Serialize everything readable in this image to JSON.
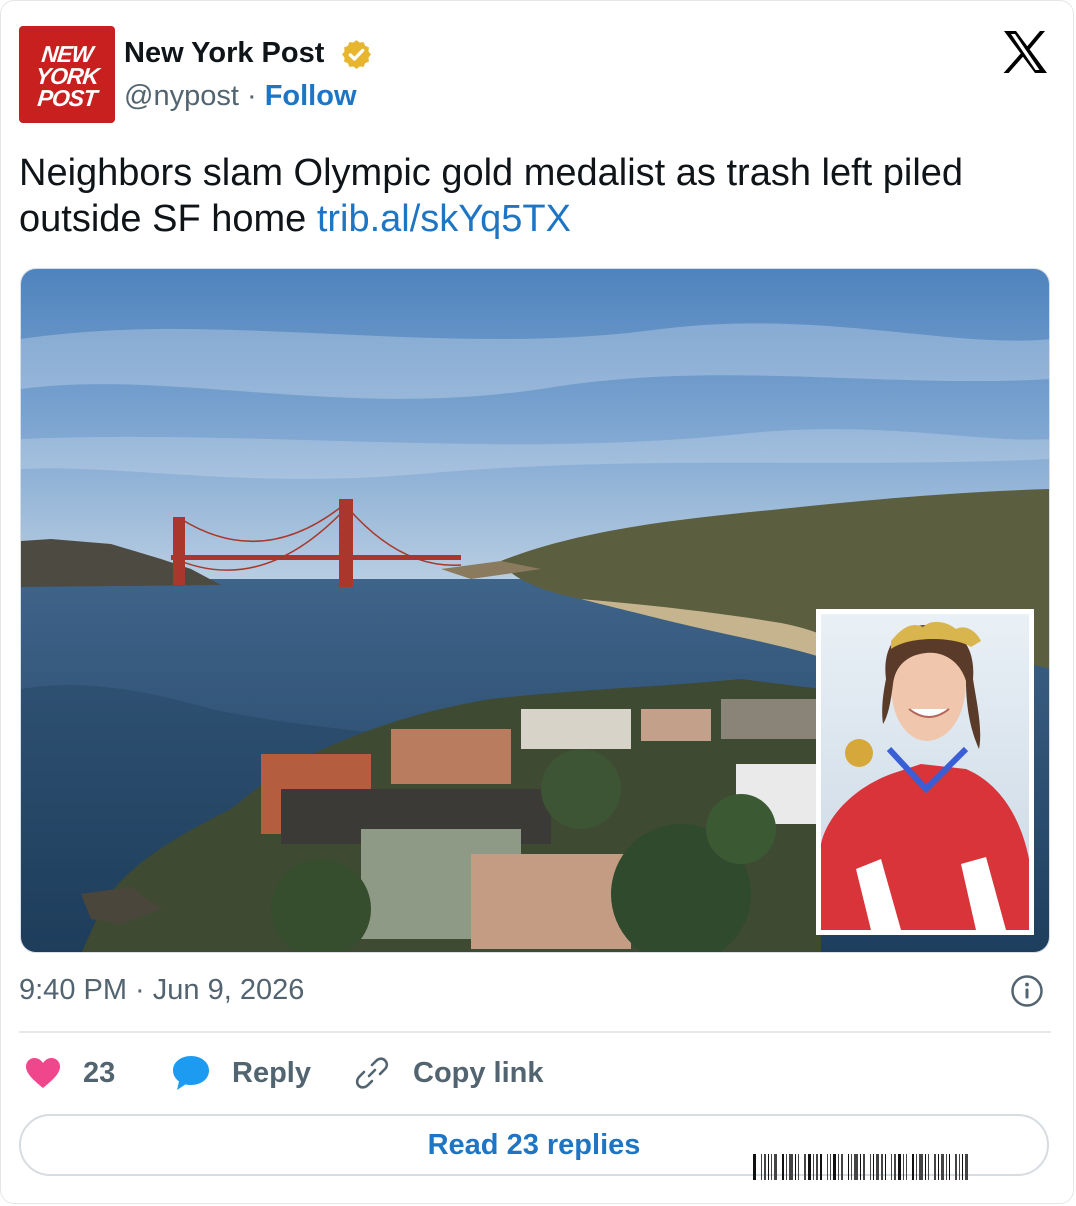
{
  "account": {
    "logo_lines": [
      "NEW",
      "YORK",
      "POST"
    ],
    "name": "New York Post",
    "handle": "@nypost",
    "separator": "·",
    "follow_label": "Follow"
  },
  "tweet": {
    "text": "Neighbors slam Olympic gold medalist as trash left piled outside SF home ",
    "link": "trib.al/skYq5TX",
    "timestamp": "9:40 PM · Jun 9, 2026"
  },
  "actions": {
    "like_count": "23",
    "reply_label": "Reply",
    "copy_label": "Copy link",
    "read_replies_label": "Read 23 replies"
  },
  "icons": {
    "verified": "verified-badge-icon",
    "platform": "x-logo-icon",
    "info": "info-icon",
    "like": "heart-icon",
    "reply": "speech-bubble-icon",
    "copy": "link-icon"
  },
  "colors": {
    "brand_red": "#c8201f",
    "link_blue": "#1d75c4",
    "muted_text": "#536471",
    "heart_pink": "#f0468b",
    "verified_gold": "#e8b52e"
  }
}
